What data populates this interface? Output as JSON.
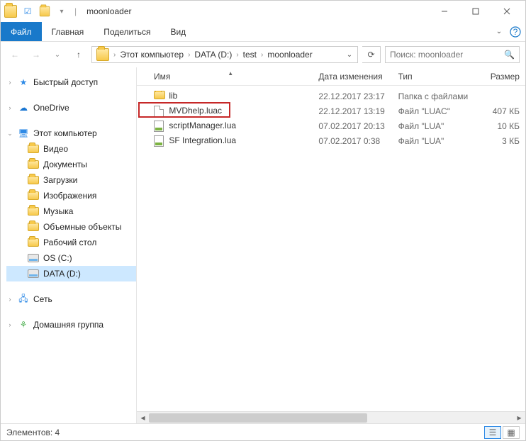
{
  "titlebar": {
    "title": "moonloader"
  },
  "ribbon": {
    "file": "Файл",
    "tabs": [
      "Главная",
      "Поделиться",
      "Вид"
    ]
  },
  "breadcrumb": {
    "items": [
      "Этот компьютер",
      "DATA (D:)",
      "test",
      "moonloader"
    ]
  },
  "search": {
    "placeholder": "Поиск: moonloader"
  },
  "sidebar": {
    "quick": "Быстрый доступ",
    "onedrive": "OneDrive",
    "thispc": "Этот компьютер",
    "pcchildren": [
      {
        "label": "Видео",
        "icon": "folder"
      },
      {
        "label": "Документы",
        "icon": "folder"
      },
      {
        "label": "Загрузки",
        "icon": "folder"
      },
      {
        "label": "Изображения",
        "icon": "folder"
      },
      {
        "label": "Музыка",
        "icon": "folder"
      },
      {
        "label": "Объемные объекты",
        "icon": "folder"
      },
      {
        "label": "Рабочий стол",
        "icon": "folder"
      },
      {
        "label": "OS (C:)",
        "icon": "drive"
      },
      {
        "label": "DATA (D:)",
        "icon": "drive",
        "selected": true
      }
    ],
    "network": "Сеть",
    "homegroup": "Домашняя группа"
  },
  "columns": {
    "name": "Имя",
    "date": "Дата изменения",
    "type": "Тип",
    "size": "Размер"
  },
  "files": [
    {
      "name": "lib",
      "date": "22.12.2017 23:17",
      "type": "Папка с файлами",
      "size": "",
      "icon": "folder"
    },
    {
      "name": "MVDhelp.luac",
      "date": "22.12.2017 13:19",
      "type": "Файл \"LUAC\"",
      "size": "407 КБ",
      "icon": "file",
      "highlighted": true
    },
    {
      "name": "scriptManager.lua",
      "date": "07.02.2017 20:13",
      "type": "Файл \"LUA\"",
      "size": "10 КБ",
      "icon": "lua"
    },
    {
      "name": "SF Integration.lua",
      "date": "07.02.2017 0:38",
      "type": "Файл \"LUA\"",
      "size": "3 КБ",
      "icon": "lua"
    }
  ],
  "statusbar": {
    "count_label": "Элементов: 4"
  }
}
